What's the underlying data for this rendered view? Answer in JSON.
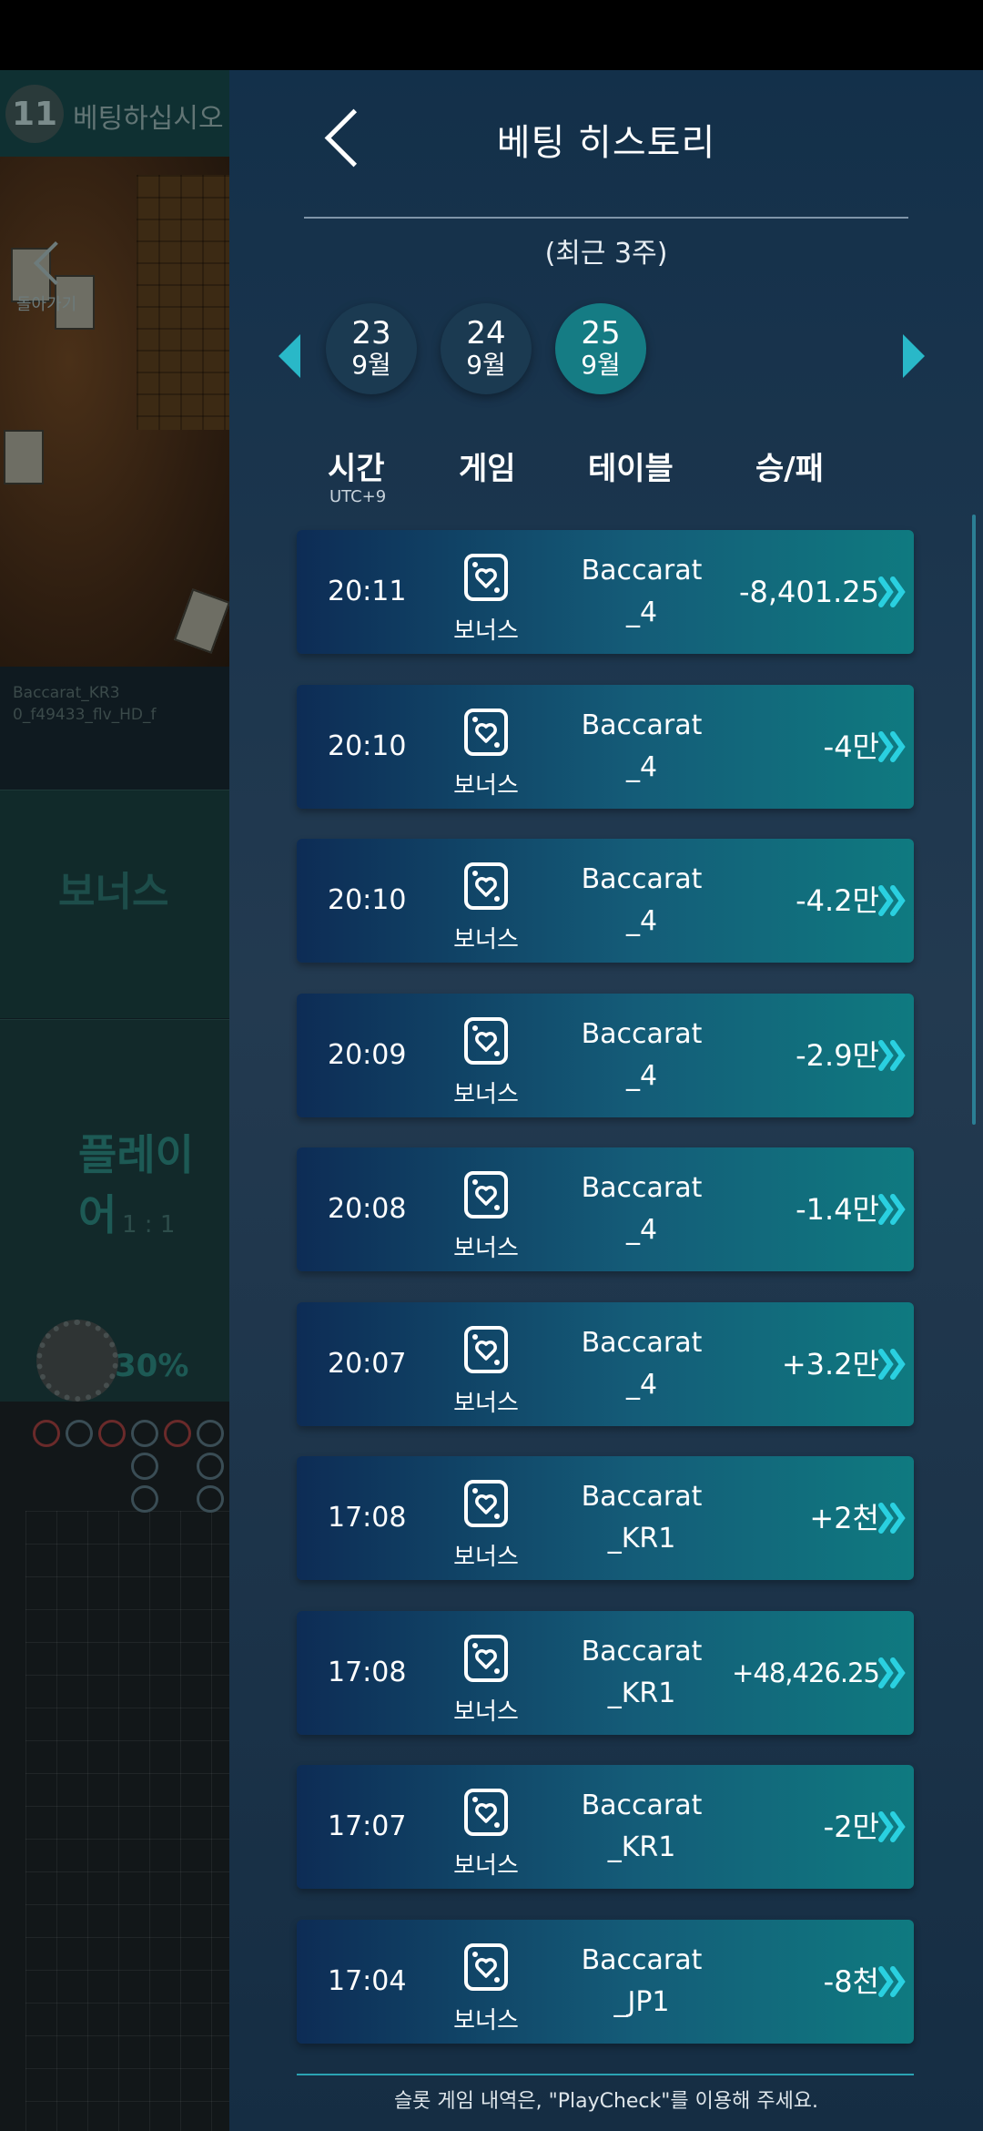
{
  "background_game": {
    "round_number": "11",
    "message": "베팅하십시오",
    "back_label": "돌아가기",
    "table_info_line1": "Baccarat_KR3",
    "table_info_line2": "0_f49433_flv_HD_f",
    "bet_bonus_label": "보너스",
    "bet_player_label": "플레이어",
    "bet_player_odds": "1 : 1",
    "bet_player_percent": "30%"
  },
  "header": {
    "title": "베팅 히스토리",
    "subtitle": "(최근 3주)"
  },
  "dates": [
    {
      "day": "23",
      "month": "9월",
      "active": false
    },
    {
      "day": "24",
      "month": "9월",
      "active": false
    },
    {
      "day": "25",
      "month": "9월",
      "active": true
    }
  ],
  "columns": {
    "time": "시간",
    "time_sub": "UTC+9",
    "game": "게임",
    "table": "테이블",
    "result": "승/패"
  },
  "rows": [
    {
      "time": "20:11",
      "game": "보너스",
      "table1": "Baccarat",
      "table2": "_4",
      "amount": "-8,401.25"
    },
    {
      "time": "20:10",
      "game": "보너스",
      "table1": "Baccarat",
      "table2": "_4",
      "amount": "-4만"
    },
    {
      "time": "20:10",
      "game": "보너스",
      "table1": "Baccarat",
      "table2": "_4",
      "amount": "-4.2만"
    },
    {
      "time": "20:09",
      "game": "보너스",
      "table1": "Baccarat",
      "table2": "_4",
      "amount": "-2.9만"
    },
    {
      "time": "20:08",
      "game": "보너스",
      "table1": "Baccarat",
      "table2": "_4",
      "amount": "-1.4만"
    },
    {
      "time": "20:07",
      "game": "보너스",
      "table1": "Baccarat",
      "table2": "_4",
      "amount": "+3.2만"
    },
    {
      "time": "17:08",
      "game": "보너스",
      "table1": "Baccarat",
      "table2": "_KR1",
      "amount": "+2천"
    },
    {
      "time": "17:08",
      "game": "보너스",
      "table1": "Baccarat",
      "table2": "_KR1",
      "amount": "+48,426.25"
    },
    {
      "time": "17:07",
      "game": "보너스",
      "table1": "Baccarat",
      "table2": "_KR1",
      "amount": "-2만"
    },
    {
      "time": "17:04",
      "game": "보너스",
      "table1": "Baccarat",
      "table2": "_JP1",
      "amount": "-8천"
    }
  ],
  "footer": "슬롯 게임 내역은, \"PlayCheck\"를 이용해 주세요.",
  "icons": {
    "back": "chevron-left-icon",
    "prev_dates": "triangle-left-icon",
    "next_dates": "triangle-right-icon",
    "game": "heart-card-icon",
    "row_detail": "double-chevron-right-icon"
  },
  "colors": {
    "accent": "#29b8c8",
    "active_date": "#157c84",
    "row_start": "#0d2c55",
    "row_end": "#0f7a80"
  }
}
